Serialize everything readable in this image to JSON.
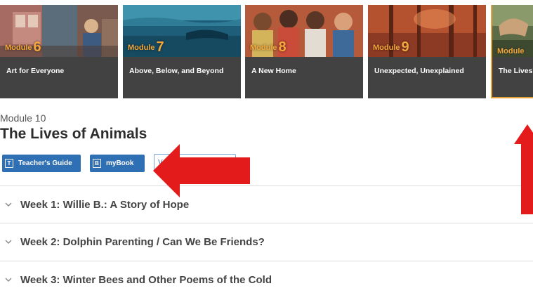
{
  "modules": [
    {
      "label": "Module",
      "number": "6",
      "title": "Art for Everyone"
    },
    {
      "label": "Module",
      "number": "7",
      "title": "Above, Below, and Beyond"
    },
    {
      "label": "Module",
      "number": "8",
      "title": "A New Home"
    },
    {
      "label": "Module",
      "number": "9",
      "title": "Unexpected, Unexplained"
    },
    {
      "label": "Module",
      "number": "",
      "title": "The Lives"
    }
  ],
  "selected_module": {
    "label": "Module 10",
    "title": "The Lives of Animals"
  },
  "resources": {
    "teachers_guide": {
      "icon_letter": "T",
      "label": "Teacher's Guide"
    },
    "mybook": {
      "icon_letter": "B",
      "label": "myBook"
    },
    "third_button_label": "V"
  },
  "weeks": [
    {
      "title": "Week 1: Willie B.: A Story of Hope"
    },
    {
      "title": "Week 2: Dolphin Parenting / Can We Be Friends?"
    },
    {
      "title": "Week 3: Winter Bees and Other Poems of the Cold"
    }
  ],
  "colors": {
    "accent_orange": "#f3a63b",
    "card_dark": "#424242",
    "button_blue": "#2f6fb3",
    "annotation_red": "#e31b1b"
  },
  "icons": {
    "week_toggle": "chevron-down-icon",
    "resource_book": "book-icon"
  }
}
